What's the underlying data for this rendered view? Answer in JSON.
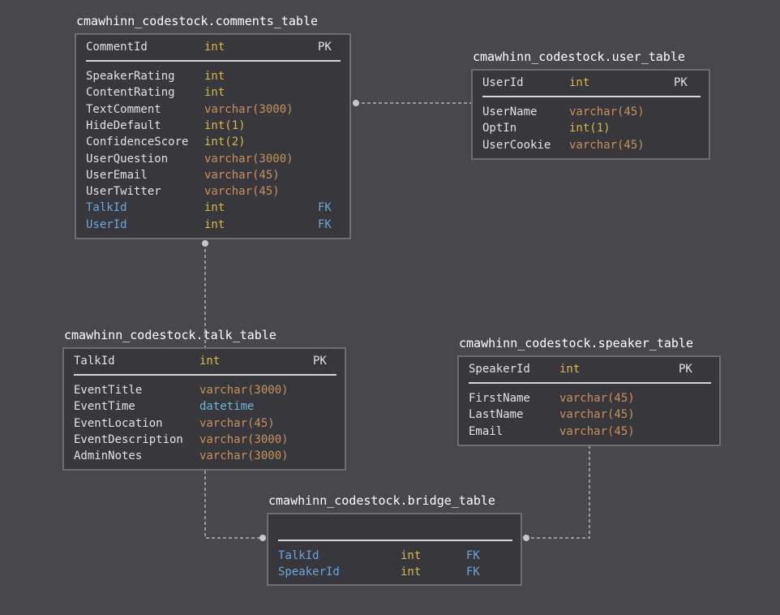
{
  "tables": {
    "comments": {
      "title": "cmawhinn_codestock.comments_table",
      "pk": [
        {
          "name": "CommentId",
          "type": "int",
          "key": "PK"
        }
      ],
      "columns": [
        {
          "name": "SpeakerRating",
          "type": "int",
          "key": ""
        },
        {
          "name": "ContentRating",
          "type": "int",
          "key": ""
        },
        {
          "name": "TextComment",
          "type": "varchar(3000)",
          "key": ""
        },
        {
          "name": "HideDefault",
          "type": "int(1)",
          "key": ""
        },
        {
          "name": "ConfidenceScore",
          "type": "int(2)",
          "key": ""
        },
        {
          "name": "UserQuestion",
          "type": "varchar(3000)",
          "key": ""
        },
        {
          "name": "UserEmail",
          "type": "varchar(45)",
          "key": ""
        },
        {
          "name": "UserTwitter",
          "type": "varchar(45)",
          "key": ""
        },
        {
          "name": "TalkId",
          "type": "int",
          "key": "FK"
        },
        {
          "name": "UserId",
          "type": "int",
          "key": "FK"
        }
      ]
    },
    "user": {
      "title": "cmawhinn_codestock.user_table",
      "pk": [
        {
          "name": "UserId",
          "type": "int",
          "key": "PK"
        }
      ],
      "columns": [
        {
          "name": "UserName",
          "type": "varchar(45)",
          "key": ""
        },
        {
          "name": "OptIn",
          "type": "int(1)",
          "key": ""
        },
        {
          "name": "UserCookie",
          "type": "varchar(45)",
          "key": ""
        }
      ]
    },
    "talk": {
      "title": "cmawhinn_codestock.talk_table",
      "pk": [
        {
          "name": "TalkId",
          "type": "int",
          "key": "PK"
        }
      ],
      "columns": [
        {
          "name": "EventTitle",
          "type": "varchar(3000)",
          "key": ""
        },
        {
          "name": "EventTime",
          "type": "datetime",
          "key": ""
        },
        {
          "name": "EventLocation",
          "type": "varchar(45)",
          "key": ""
        },
        {
          "name": "EventDescription",
          "type": "varchar(3000)",
          "key": ""
        },
        {
          "name": "AdminNotes",
          "type": "varchar(3000)",
          "key": ""
        }
      ]
    },
    "speaker": {
      "title": "cmawhinn_codestock.speaker_table",
      "pk": [
        {
          "name": "SpeakerId",
          "type": "int",
          "key": "PK"
        }
      ],
      "columns": [
        {
          "name": "FirstName",
          "type": "varchar(45)",
          "key": ""
        },
        {
          "name": "LastName",
          "type": "varchar(45)",
          "key": ""
        },
        {
          "name": "Email",
          "type": "varchar(45)",
          "key": ""
        }
      ]
    },
    "bridge": {
      "title": "cmawhinn_codestock.bridge_table",
      "pk": [],
      "columns": [
        {
          "name": "TalkId",
          "type": "int",
          "key": "FK"
        },
        {
          "name": "SpeakerId",
          "type": "int",
          "key": "FK"
        }
      ]
    }
  },
  "colors": {
    "background": "#48484c",
    "table_fill": "#38383c",
    "table_border": "#6e6e72",
    "text": "#e2e2e2",
    "foreign_key": "#6aa6dc",
    "int_type": "#d9b847",
    "varchar_type": "#c8905c",
    "datetime_type": "#6bb8d8",
    "connector": "#b4b4b8"
  }
}
